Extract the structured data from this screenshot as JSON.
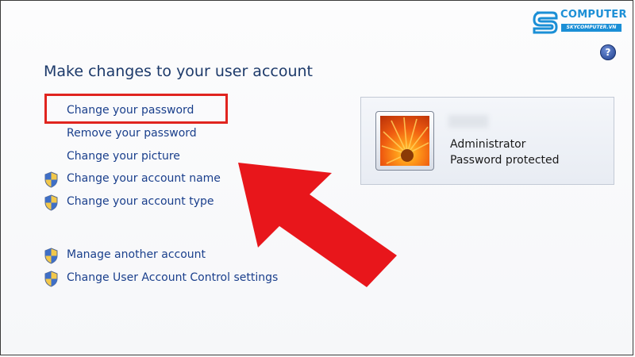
{
  "brand": {
    "name": "COMPUTER",
    "site": "SKYCOMPUTER.VN",
    "color": "#1b8fd6"
  },
  "help_icon": {
    "glyph": "?",
    "icon": "help-icon"
  },
  "page": {
    "title": "Make changes to your user account"
  },
  "tasks": [
    {
      "label": "Change your password",
      "shield": false,
      "highlighted": true
    },
    {
      "label": "Remove your password",
      "shield": false
    },
    {
      "label": "Change your picture",
      "shield": false
    },
    {
      "label": "Change your account name",
      "shield": true
    },
    {
      "label": "Change your account type",
      "shield": true
    }
  ],
  "other_tasks": [
    {
      "label": "Manage another account",
      "shield": true
    },
    {
      "label": "Change User Account Control settings",
      "shield": true
    }
  ],
  "account": {
    "account_type": "Administrator",
    "status": "Password protected",
    "picture_icon": "flower-picture"
  },
  "colors": {
    "link": "#1a3f8c",
    "title": "#1d3a6a",
    "annotation": "#e0241f"
  }
}
